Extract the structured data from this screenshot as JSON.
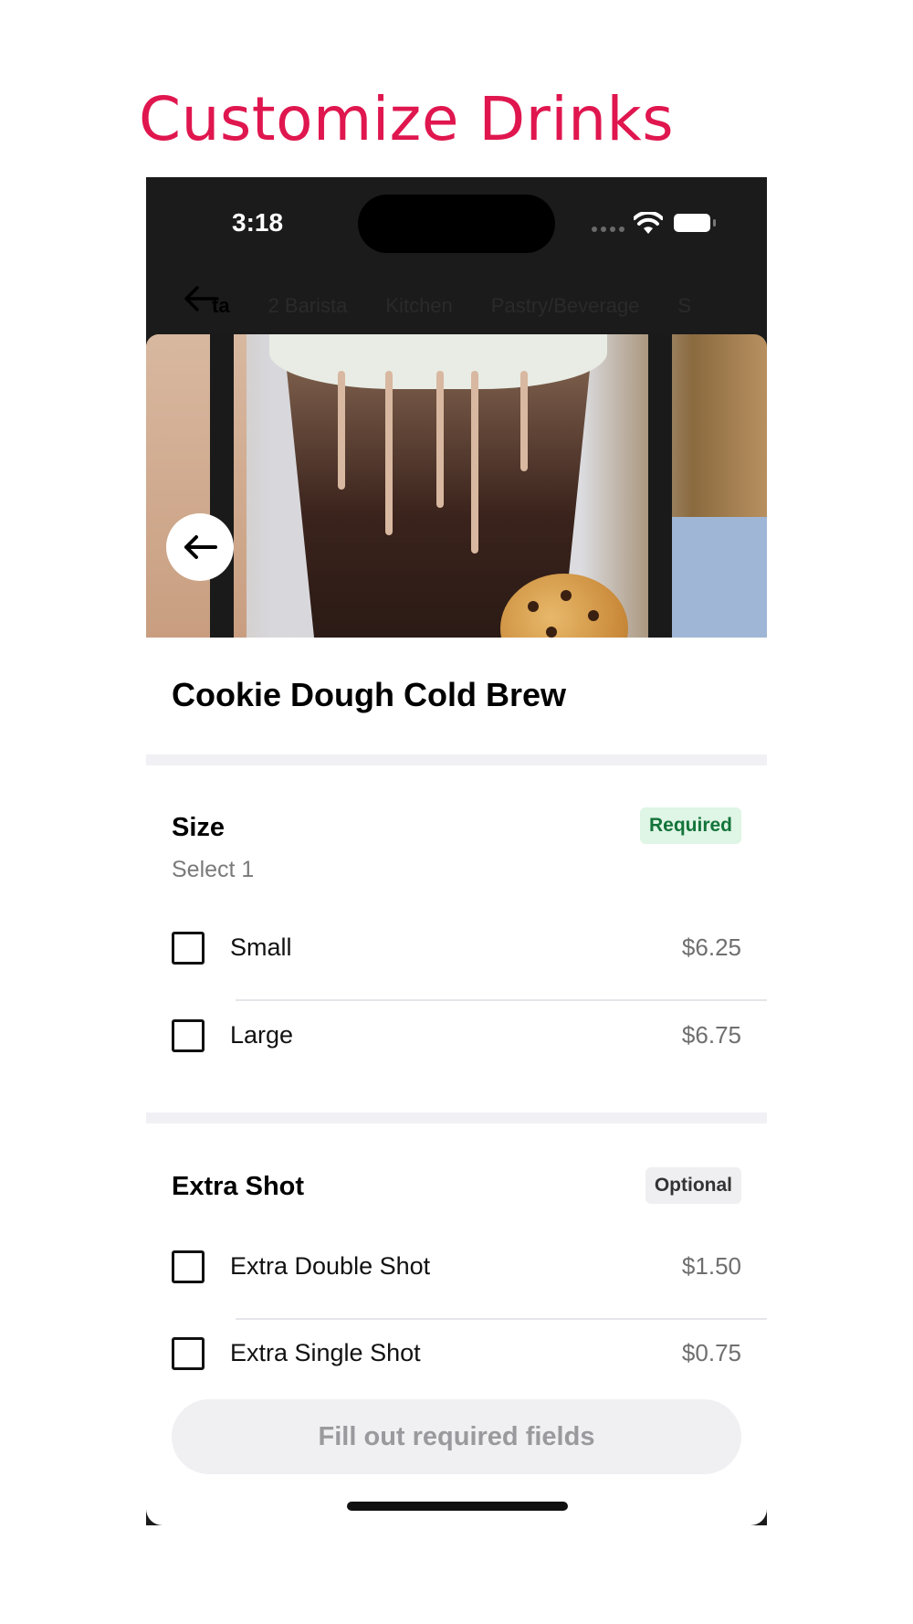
{
  "headline": "Customize Drinks",
  "status_bar": {
    "time": "3:18"
  },
  "category_tabs": [
    "ta",
    "2 Barista",
    "Kitchen",
    "Pastry/Beverage",
    "S"
  ],
  "item": {
    "name": "Cookie Dough Cold Brew"
  },
  "sections": [
    {
      "title": "Size",
      "subtitle": "Select 1",
      "badge": "Required",
      "options": [
        {
          "label": "Small",
          "price": "$6.25"
        },
        {
          "label": "Large",
          "price": "$6.75"
        }
      ]
    },
    {
      "title": "Extra Shot",
      "badge": "Optional",
      "options": [
        {
          "label": "Extra Double Shot",
          "price": "$1.50"
        },
        {
          "label": "Extra Single Shot",
          "price": "$0.75"
        }
      ]
    }
  ],
  "cta_label": "Fill out required fields",
  "colors": {
    "headline": "#e0164f",
    "required_badge_bg": "#dff5e5",
    "required_badge_text": "#13743a",
    "optional_badge_bg": "#efeff2"
  },
  "icons": {
    "back_button": "arrow-left-icon",
    "header_back": "arrow-left-icon",
    "wifi": "wifi-icon",
    "battery": "battery-icon",
    "signal": "cellular-signal-icon"
  }
}
